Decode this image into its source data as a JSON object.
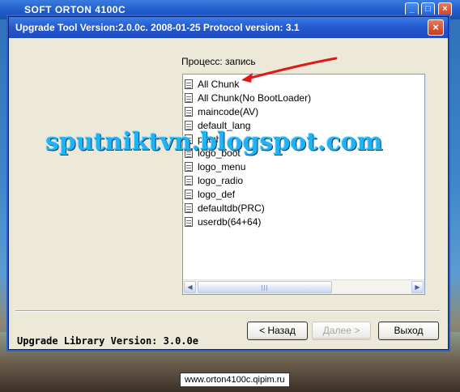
{
  "outer_window": {
    "title": "SOFT ORTON 4100C",
    "controls": {
      "minimize": "_",
      "maximize": "□",
      "close": "×"
    }
  },
  "dialog": {
    "title": "Upgrade Tool Version:2.0.0c. 2008-01-25 Protocol version: 3.1",
    "close_glyph": "×",
    "status_label": "Процесс: запись",
    "list_items": [
      "All Chunk",
      "All Chunk(No BootLoader)",
      "maincode(AV)",
      "default_lang",
      "patch",
      "logo_boot",
      "logo_menu",
      "logo_radio",
      "logo_def",
      "defaultdb(PRC)",
      "userdb(64+64)"
    ],
    "library_version": "Upgrade Library Version: 3.0.0e",
    "buttons": {
      "back": "< Назад",
      "next": "Далее >",
      "exit": "Выход"
    }
  },
  "watermarks": {
    "blog": "sputniktvn.blogspot.com",
    "site": "www.orton4100c.qipim.ru"
  },
  "colors": {
    "titlebar": "#2559cf",
    "close_button": "#c43d20",
    "annotation_arrow": "#e01818",
    "watermark_blog": "#1fb3f5"
  },
  "icons": {
    "list_item": "document-icon",
    "scroll_left": "arrow-left-icon",
    "scroll_right": "arrow-right-icon"
  }
}
